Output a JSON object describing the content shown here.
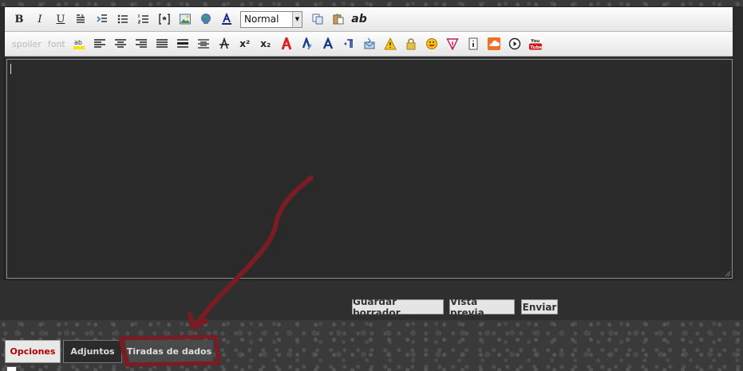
{
  "toolbar": {
    "font_size_value": "Normal",
    "spoiler_label": "spoiler",
    "font_label": "font",
    "bold_label": "B",
    "italic_label": "I",
    "underline_label": "U",
    "strike_label": "ab",
    "sup_label": "x²",
    "sub_label": "x₂"
  },
  "buttons": {
    "save_draft": "Guardar borrador",
    "preview": "Vista previa",
    "send": "Enviar"
  },
  "tabs": {
    "options": "Opciones",
    "attachments": "Adjuntos",
    "dice": "Tiradas de dados"
  },
  "colors": {
    "annotation": "#7a1c24",
    "active_tab_text": "#b00000"
  }
}
